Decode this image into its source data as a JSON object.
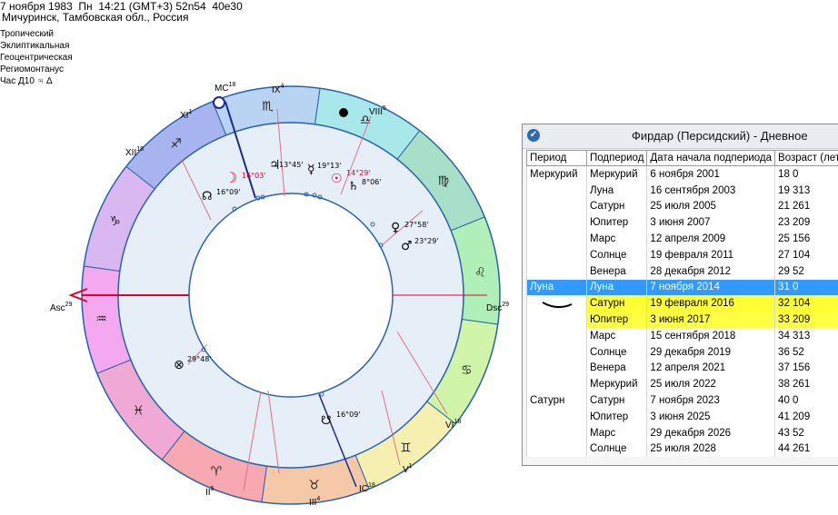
{
  "header": {
    "line1": "7 ноября 1983  Пн  14:21 (GMT+3) 52n54  40e30",
    "line2": "Мичуринск, Тамбовская обл., Россия",
    "options": [
      "Тропический",
      "Эклиптикальная",
      "Геоцентрическая",
      "Региомонтанус",
      "Час Д10  ♃  Δ"
    ]
  },
  "chart": {
    "signs": [
      "♐",
      "♑",
      "♒",
      "♓",
      "♈",
      "♉",
      "♊",
      "♋",
      "♌",
      "♍",
      "♎",
      "♏"
    ],
    "angles": {
      "asc": "Asc",
      "asc_deg": "29",
      "dsc": "Dsc",
      "dsc_deg": "29",
      "mc": "MC",
      "mc_deg": "18",
      "ic": "IC",
      "ic_deg": "18"
    },
    "houses": [
      {
        "label": "IX",
        "deg": "4"
      },
      {
        "label": "VIII",
        "deg": "5"
      },
      {
        "label": "XI",
        "deg": "1"
      },
      {
        "label": "XII",
        "deg": "18"
      },
      {
        "label": "VI",
        "deg": "18"
      },
      {
        "label": "V",
        "deg": "1"
      },
      {
        "label": "III",
        "deg": "4"
      },
      {
        "label": "II",
        "deg": "5"
      }
    ],
    "planets": [
      {
        "glyph": "☽",
        "deg": "16°03'",
        "color": "#d4002a"
      },
      {
        "glyph": "☊",
        "deg": "16°09'",
        "color": "#000"
      },
      {
        "glyph": "♃",
        "deg": "13°45'",
        "color": "#000"
      },
      {
        "glyph": "☿",
        "deg": "19°13'",
        "color": "#000"
      },
      {
        "glyph": "☉",
        "deg": "14°29'",
        "color": "#d4002a"
      },
      {
        "glyph": "♄",
        "deg": "8°06'",
        "color": "#000"
      },
      {
        "glyph": "♀",
        "deg": "27°58'",
        "color": "#000"
      },
      {
        "glyph": "♂",
        "deg": "23°29'",
        "color": "#000"
      },
      {
        "glyph": "⊗",
        "deg": "29°48'",
        "color": "#000"
      },
      {
        "glyph": "☋",
        "deg": "16°09'",
        "color": "#000"
      }
    ]
  },
  "window": {
    "title": "Фирдар (Персидский) - Дневное",
    "columns": [
      "Период",
      "Подпериод",
      "Дата начала подпериода",
      "Возраст (лет)"
    ],
    "rows": [
      [
        "Меркурий",
        "Меркурий",
        "6 ноября 2001",
        "18 0"
      ],
      [
        "",
        "Луна",
        "16 сентября 2003",
        "19 313"
      ],
      [
        "",
        "Сатурн",
        "25 июля 2005",
        "21 261"
      ],
      [
        "",
        "Юпитер",
        "3 июня 2007",
        "23 209"
      ],
      [
        "",
        "Марс",
        "12 апреля 2009",
        "25 156"
      ],
      [
        "",
        "Солнце",
        "19 февраля 2011",
        "27 104"
      ],
      [
        "",
        "Венера",
        "28 декабря 2012",
        "29 52"
      ],
      [
        "Луна",
        "Луна",
        "7 ноября 2014",
        "31 0"
      ],
      [
        "",
        "Сатурн",
        "19 февраля 2016",
        "32 104"
      ],
      [
        "",
        "Юпитер",
        "3 июня 2017",
        "33 209"
      ],
      [
        "",
        "Марс",
        "15 сентября 2018",
        "34 313"
      ],
      [
        "",
        "Солнце",
        "29 декабря 2019",
        "36 52"
      ],
      [
        "",
        "Венера",
        "12 апреля 2021",
        "37 156"
      ],
      [
        "",
        "Меркурий",
        "25 июля 2022",
        "38 261"
      ],
      [
        "Сатурн",
        "Сатурн",
        "7 ноября 2023",
        "40 0"
      ],
      [
        "",
        "Юпитер",
        "3 июня 2025",
        "41 209"
      ],
      [
        "",
        "Марс",
        "29 декабря 2026",
        "43 52"
      ],
      [
        "",
        "Солнце",
        "25 июля 2028",
        "44 261"
      ]
    ],
    "selected_row": 7,
    "highlight_rows": [
      8,
      9
    ],
    "colors": {
      "selection": "#3399ff",
      "highlight": "#ffff33"
    }
  }
}
